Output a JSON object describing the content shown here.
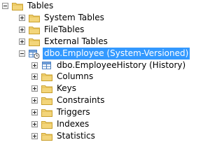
{
  "tree": {
    "root": {
      "label": "Tables",
      "expanded": true
    },
    "children": [
      {
        "label": "System Tables",
        "icon": "folder-icon",
        "expanded": false
      },
      {
        "label": "FileTables",
        "icon": "folder-icon",
        "expanded": false
      },
      {
        "label": "External Tables",
        "icon": "folder-icon",
        "expanded": false
      },
      {
        "label": "dbo.Employee (System-Versioned)",
        "icon": "temporal-table-icon",
        "expanded": true,
        "selected": true,
        "children": [
          {
            "label": "dbo.EmployeeHistory (History)",
            "icon": "table-icon",
            "expanded": false
          },
          {
            "label": "Columns",
            "icon": "folder-icon",
            "expanded": false
          },
          {
            "label": "Keys",
            "icon": "folder-icon",
            "expanded": false
          },
          {
            "label": "Constraints",
            "icon": "folder-icon",
            "expanded": false
          },
          {
            "label": "Triggers",
            "icon": "folder-icon",
            "expanded": false
          },
          {
            "label": "Indexes",
            "icon": "folder-icon",
            "expanded": false
          },
          {
            "label": "Statistics",
            "icon": "folder-icon",
            "expanded": false
          }
        ]
      }
    ]
  },
  "colors": {
    "selection": "#3399ff",
    "folder": "#e8c05a",
    "table": "#4a7fc1"
  }
}
